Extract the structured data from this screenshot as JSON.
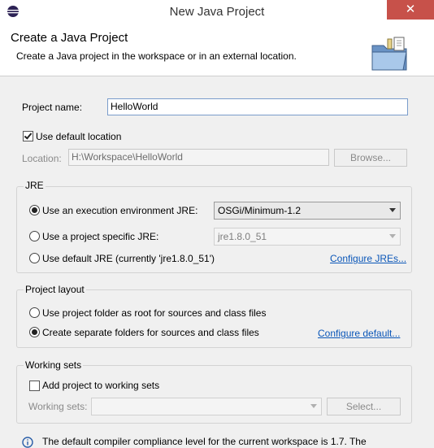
{
  "window": {
    "title": "New Java Project",
    "close_glyph": "✕"
  },
  "banner": {
    "title": "Create a Java Project",
    "description": "Create a Java project in the workspace or in an external location."
  },
  "project_name": {
    "label": "Project name:",
    "value": "HelloWorld"
  },
  "default_location": {
    "label": "Use default location",
    "checked": true
  },
  "location": {
    "label": "Location:",
    "value": "H:\\Workspace\\HelloWorld",
    "browse_label": "Browse..."
  },
  "jre": {
    "group_title": "JRE",
    "exec_env_label": "Use an execution environment JRE:",
    "exec_env_value": "OSGi/Minimum-1.2",
    "project_specific_label": "Use a project specific JRE:",
    "project_specific_value": "jre1.8.0_51",
    "default_label": "Use default JRE (currently 'jre1.8.0_51')",
    "configure_link": "Configure JREs...",
    "selected": "exec_env"
  },
  "layout": {
    "group_title": "Project layout",
    "option_root_label": "Use project folder as root for sources and class files",
    "option_separate_label": "Create separate folders for sources and class files",
    "configure_link": "Configure default...",
    "selected": "separate"
  },
  "working_sets": {
    "group_title": "Working sets",
    "add_label": "Add project to working sets",
    "checked": false,
    "sets_label": "Working sets:",
    "select_label": "Select..."
  },
  "info": {
    "text": "The default compiler compliance level for the current workspace is 1.7. The"
  },
  "colors": {
    "close_button": "#c7514a",
    "link": "#0a56b8"
  }
}
